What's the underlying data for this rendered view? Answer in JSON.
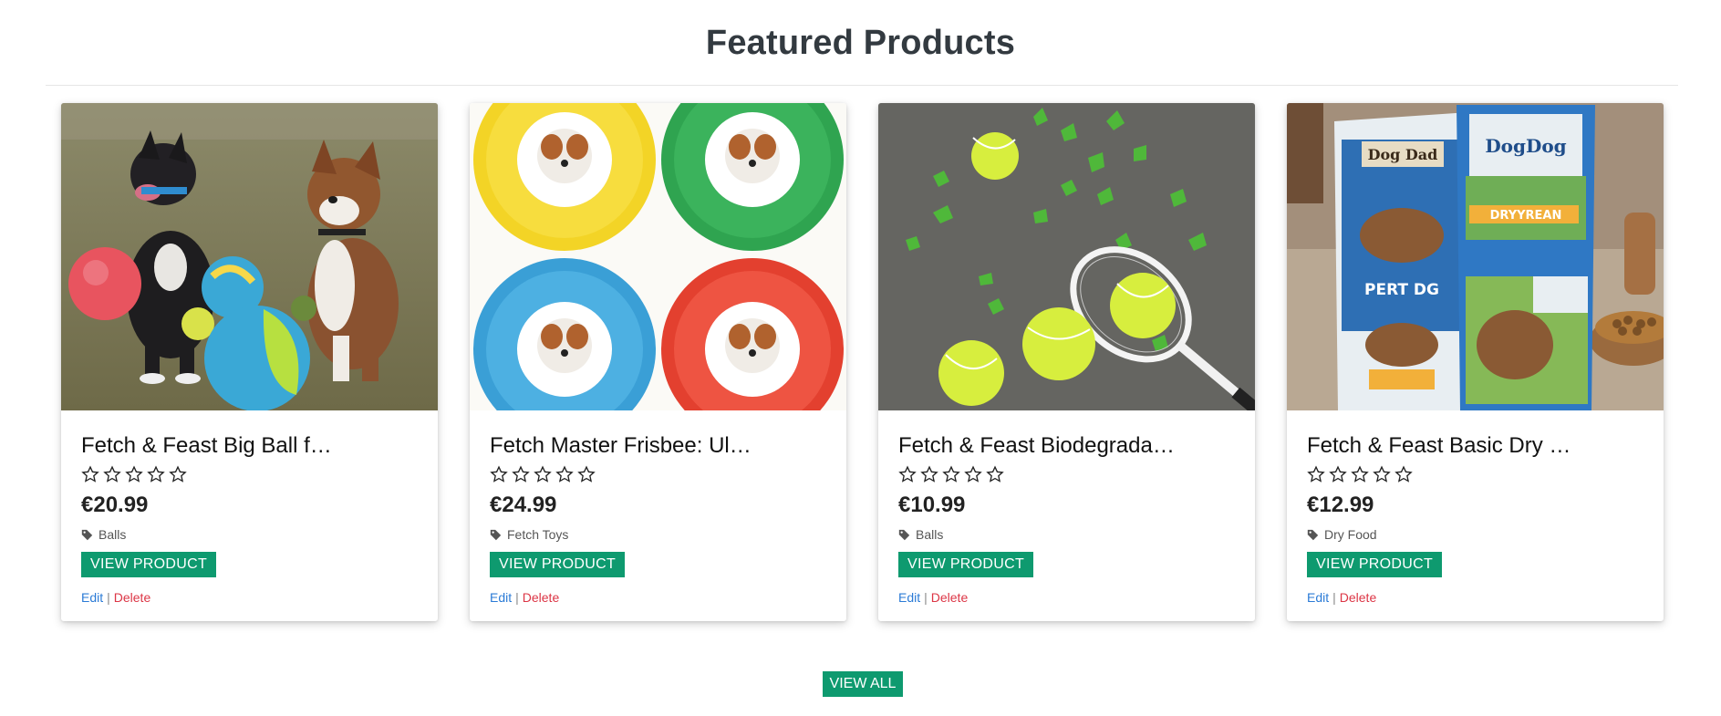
{
  "section": {
    "title": "Featured Products",
    "view_all_label": "VIEW ALL"
  },
  "colors": {
    "button_green": "#0e9a6f",
    "edit_link": "#2b7bd6",
    "delete_link": "#dc3545"
  },
  "products": [
    {
      "image_alt": "Two dogs sitting on grass next to colorful balls",
      "name": "Fetch & Feast Big Ball f…",
      "rating_stars": 0,
      "rating_max": 5,
      "price": "€20.99",
      "category": "Balls",
      "category_icon": "tag-icon",
      "view_label": "VIEW PRODUCT",
      "edit_label": "Edit",
      "separator": "|",
      "delete_label": "Delete"
    },
    {
      "image_alt": "Four colored frisbees each with a small dog in the center",
      "name": "Fetch Master Frisbee: Ul…",
      "rating_stars": 0,
      "rating_max": 5,
      "price": "€24.99",
      "category": "Fetch Toys",
      "category_icon": "tag-icon",
      "view_label": "VIEW PRODUCT",
      "edit_label": "Edit",
      "separator": "|",
      "delete_label": "Delete"
    },
    {
      "image_alt": "Tennis balls and a racket on gray ground with green leaves",
      "name": "Fetch & Feast Biodegrada…",
      "rating_stars": 0,
      "rating_max": 5,
      "price": "€10.99",
      "category": "Balls",
      "category_icon": "tag-icon",
      "view_label": "VIEW PRODUCT",
      "edit_label": "Edit",
      "separator": "|",
      "delete_label": "Delete"
    },
    {
      "image_alt": "Bags of dry dog food next to a bowl of kibble",
      "name": "Fetch & Feast Basic Dry …",
      "rating_stars": 0,
      "rating_max": 5,
      "price": "€12.99",
      "category": "Dry Food",
      "category_icon": "tag-icon",
      "view_label": "VIEW PRODUCT",
      "edit_label": "Edit",
      "separator": "|",
      "delete_label": "Delete"
    }
  ]
}
